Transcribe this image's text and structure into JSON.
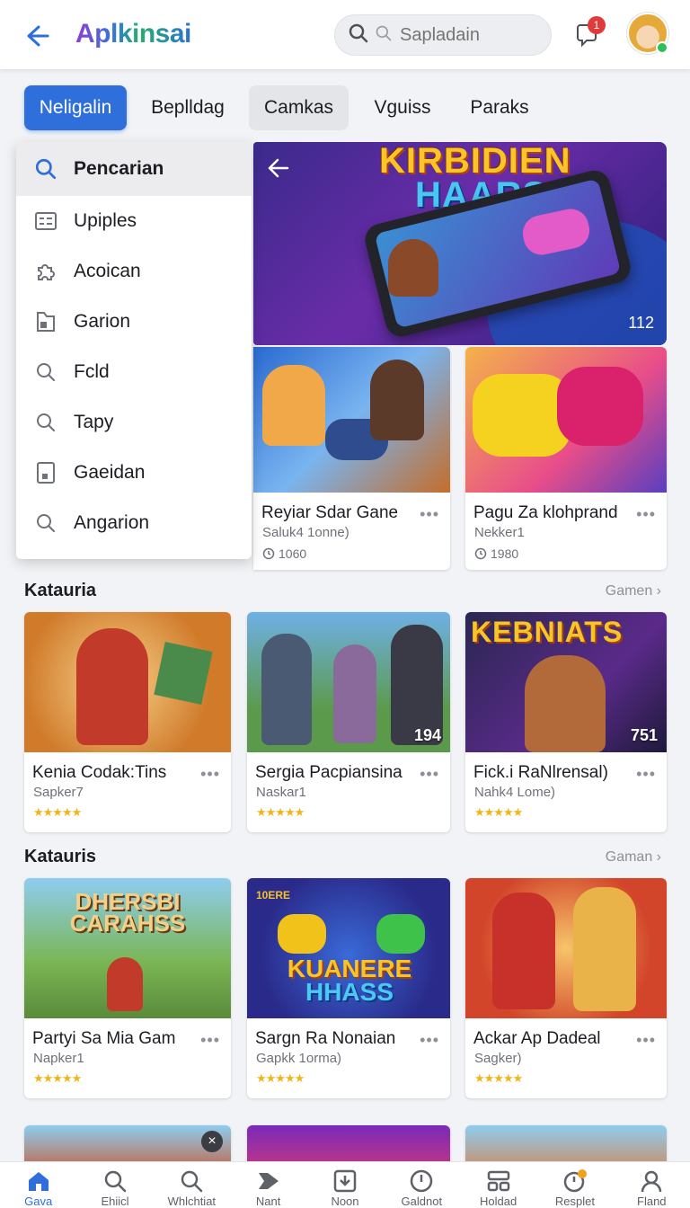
{
  "app": {
    "title": "Aplkinsai"
  },
  "search": {
    "placeholder": "Sapladain"
  },
  "notifications": {
    "count": "1"
  },
  "tabs": [
    {
      "label": "Neligalin"
    },
    {
      "label": "Beplldag"
    },
    {
      "label": "Camkas"
    },
    {
      "label": "Vguiss"
    },
    {
      "label": "Paraks"
    }
  ],
  "dropdown": {
    "items": [
      {
        "label": "Pencarian",
        "icon": "search-icon"
      },
      {
        "label": "Upiples",
        "icon": "list-icon"
      },
      {
        "label": "Acoican",
        "icon": "puzzle-icon"
      },
      {
        "label": "Garion",
        "icon": "folder-icon"
      },
      {
        "label": "Fcld",
        "icon": "search-icon"
      },
      {
        "label": "Tapy",
        "icon": "search-icon"
      },
      {
        "label": "Gaeidan",
        "icon": "tablet-icon"
      },
      {
        "label": "Angarion",
        "icon": "search-icon"
      }
    ]
  },
  "hero": {
    "title_line1": "KIRBIDIEN",
    "title_line2": "HAARS",
    "count": "112"
  },
  "featured": [
    {
      "name": "Reyiar Sdar Gane",
      "sub": "Saluk4 1onne)",
      "meta": "1060"
    },
    {
      "name": "Pagu Za klohprand",
      "sub": "Nekker1",
      "meta": "1980"
    }
  ],
  "section1": {
    "title": "Katauria",
    "link": "Gamen",
    "cards": [
      {
        "name": "Kenia Codak:Tins",
        "sub": "Sapker7",
        "num": ""
      },
      {
        "name": "Sergia Pacpiansina",
        "sub": "Naskar1",
        "num": "194"
      },
      {
        "name": "Fick.i RaNlrensal)",
        "sub": "Nahk4 Lome)",
        "num": "751",
        "thumb_title": "KEBNIATS"
      }
    ]
  },
  "section2": {
    "title": "Katauris",
    "link": "Gaman",
    "cards": [
      {
        "name": "Partyi Sa Mia Gam",
        "sub": "Napker1",
        "thumb_title1": "DHERSBI",
        "thumb_title2": "CARAHSS"
      },
      {
        "name": "Sargn Ra Nonaian",
        "sub": "Gapkk 1orma)",
        "thumb_title1": "KUANERE",
        "thumb_title2": "HHASS",
        "corner": "10ERE"
      },
      {
        "name": "Ackar Ap Dadeal",
        "sub": "Sagker)"
      }
    ]
  },
  "rating": "★★★★★",
  "more": "•••",
  "nav": [
    {
      "label": "Gava",
      "icon": "home-icon"
    },
    {
      "label": "Ehiicl",
      "icon": "search-icon"
    },
    {
      "label": "Whlchtiat",
      "icon": "search-icon"
    },
    {
      "label": "Nant",
      "icon": "forward-icon"
    },
    {
      "label": "Noon",
      "icon": "download-icon"
    },
    {
      "label": "Galdnot",
      "icon": "clock-icon"
    },
    {
      "label": "Holdad",
      "icon": "grid-icon"
    },
    {
      "label": "Resplet",
      "icon": "timer-icon"
    },
    {
      "label": "Fland",
      "icon": "user-icon"
    }
  ],
  "colors": {
    "accent": "#2f6fdb",
    "star": "#f1b51c",
    "badge": "#e13a3a"
  }
}
